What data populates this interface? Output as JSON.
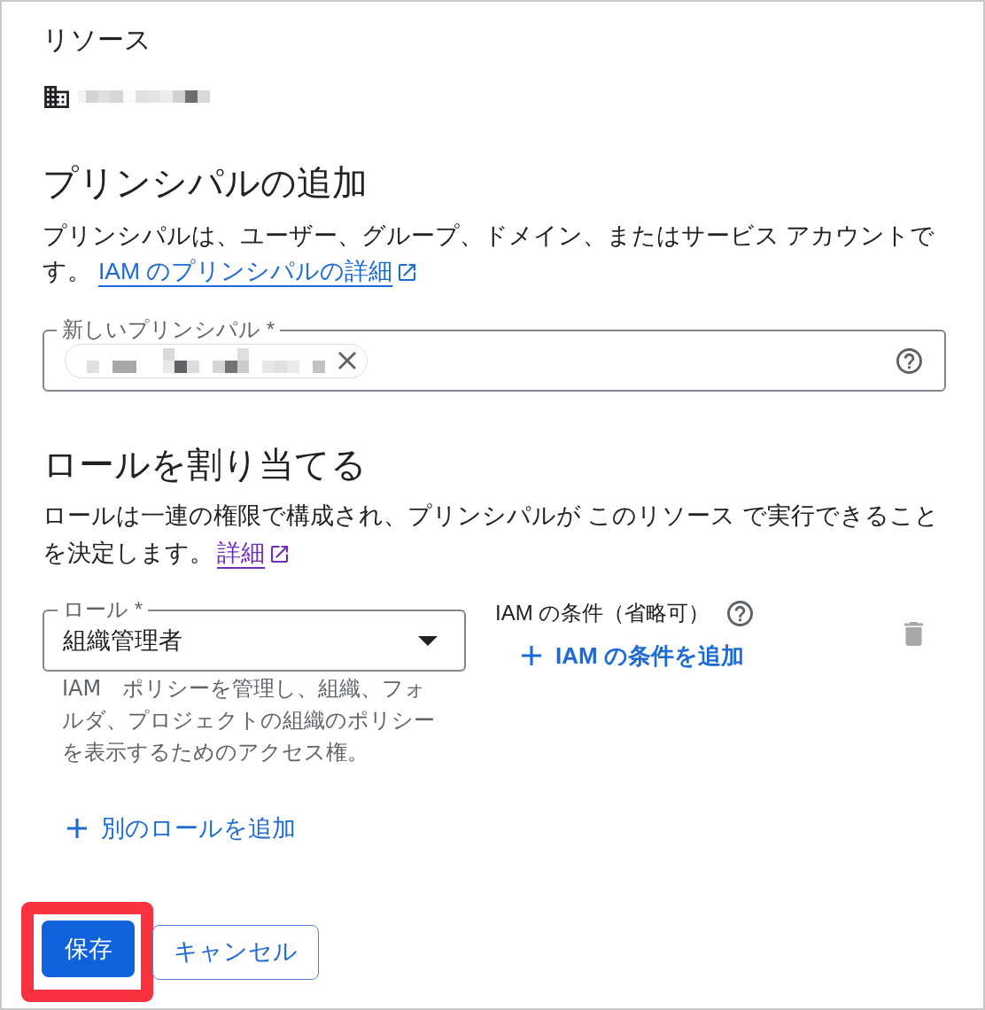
{
  "resource": {
    "title": "リソース",
    "redacted": true
  },
  "add_principals": {
    "title": "プリンシパルの追加",
    "description": "プリンシパルは、ユーザー、グループ、ドメイン、またはサービス アカウントです。",
    "link": {
      "label": "IAM のプリンシパルの詳細",
      "visited": false
    }
  },
  "new_principals": {
    "label": "新しいプリンシパル *",
    "chips": [
      {
        "redacted": true
      }
    ]
  },
  "assign_roles": {
    "title": "ロールを割り当てる",
    "description": "ロールは一連の権限で構成され、プリンシパルが このリソース で実行できることを決定します。",
    "link": {
      "label": "詳細",
      "visited": true
    }
  },
  "roles": [
    {
      "label": "ロール *",
      "value": "組織管理者",
      "description": "IAM ポリシーを管理し、組織、フォルダ、プロジェクトの組織のポリシーを表示するためのアクセス権。",
      "condition_label": "IAM の条件（省略可）",
      "add_condition": "IAM の条件を追加",
      "delete_disabled": true
    }
  ],
  "add_role": "別のロールを追加",
  "buttons": [
    {
      "label": "保存",
      "kind": "primary",
      "highlighted": true
    },
    {
      "label": "キャンセル",
      "kind": "outlined",
      "highlighted": false
    }
  ]
}
